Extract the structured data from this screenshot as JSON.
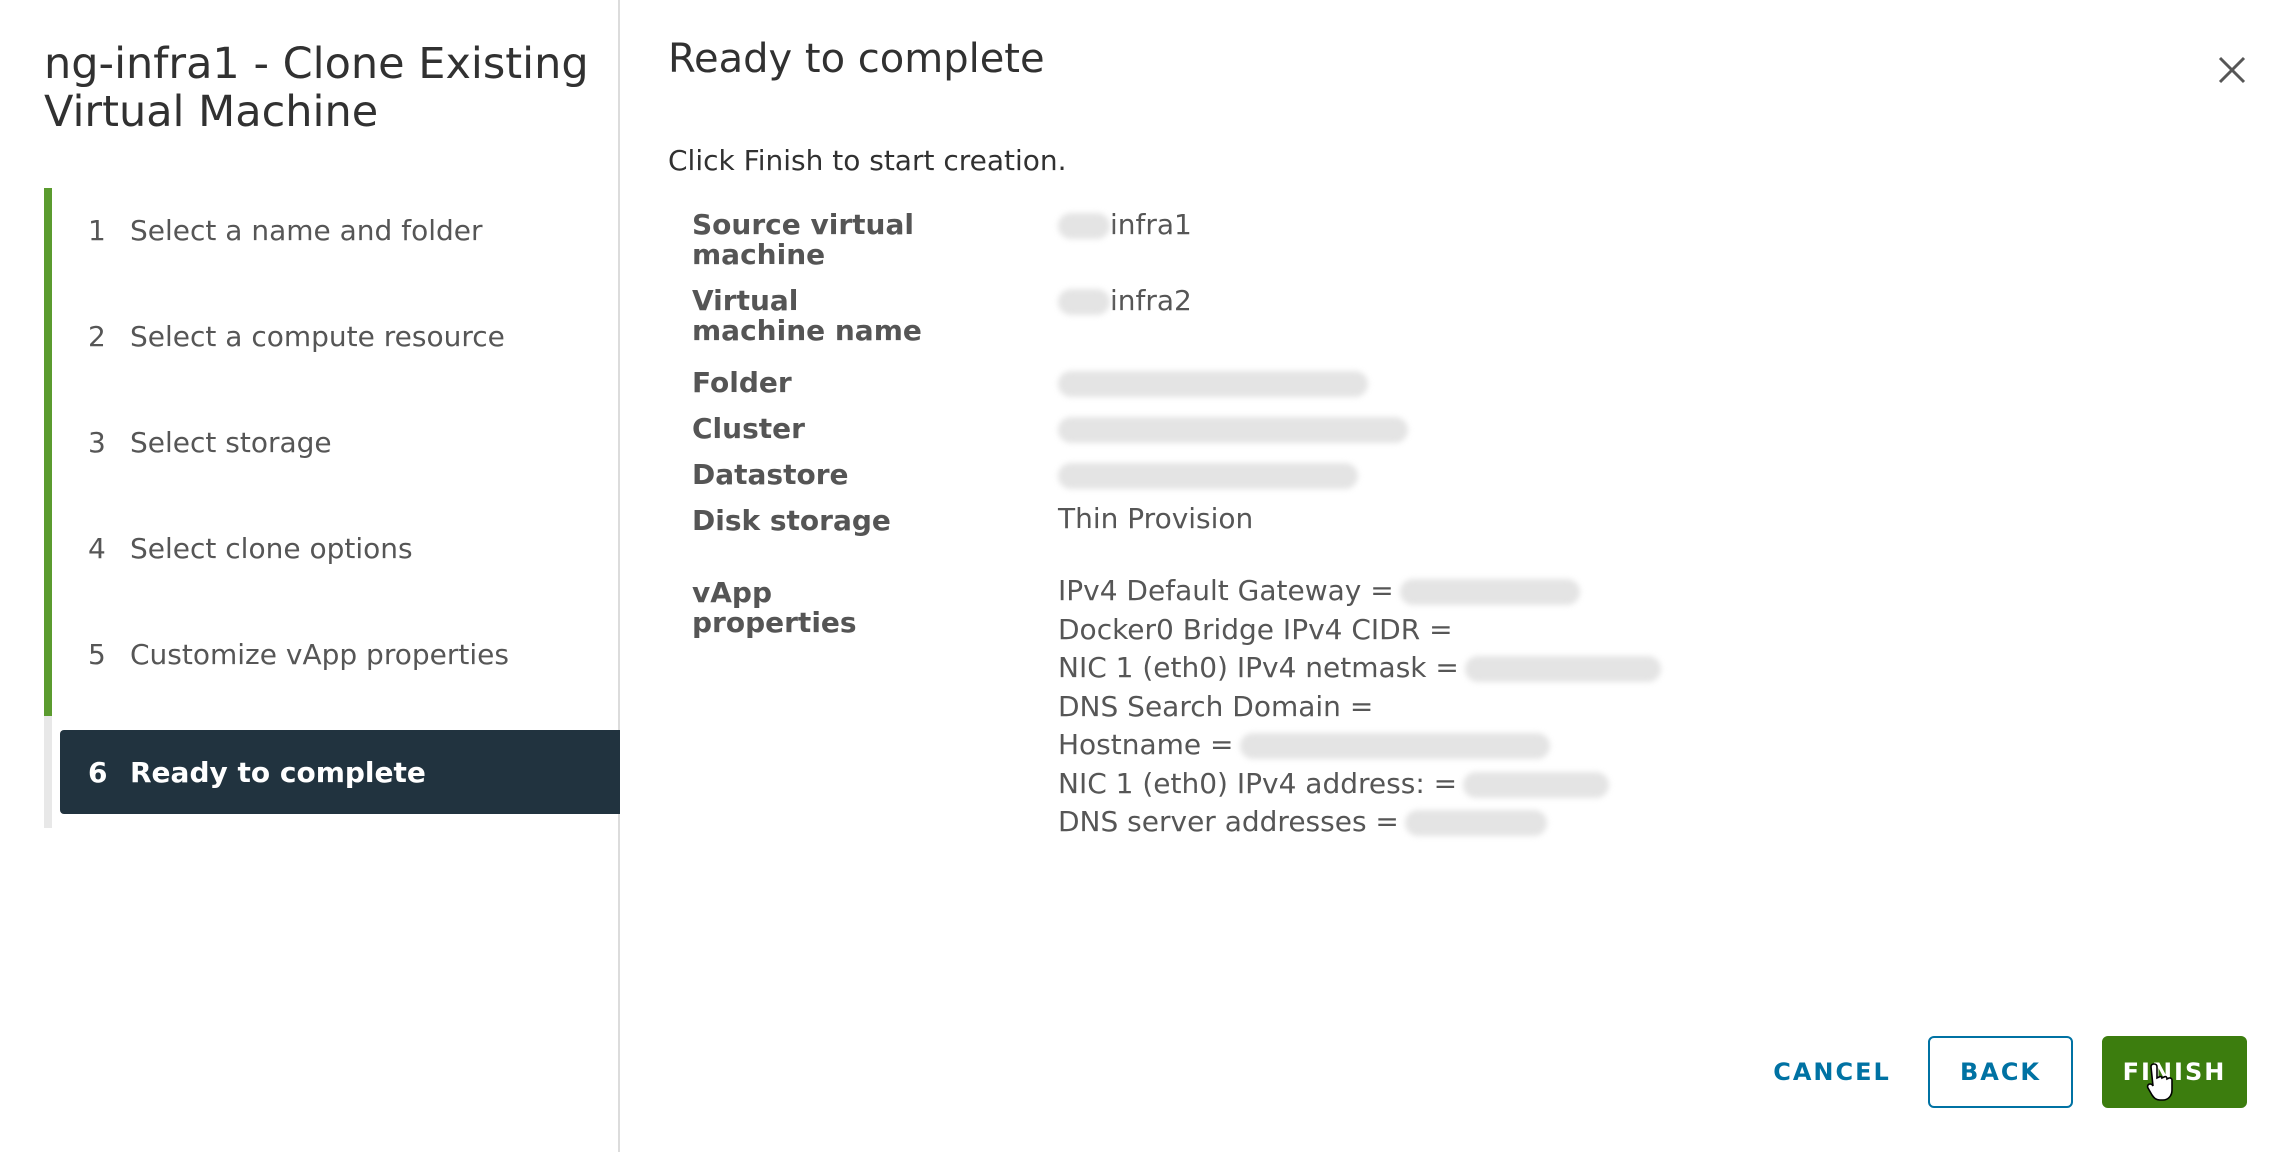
{
  "dialog": {
    "title": "ng-infra1 - Clone Existing Virtual Machine"
  },
  "steps": [
    {
      "number": "1",
      "label": "Select a name and folder"
    },
    {
      "number": "2",
      "label": "Select a compute resource"
    },
    {
      "number": "3",
      "label": "Select storage"
    },
    {
      "number": "4",
      "label": "Select clone options"
    },
    {
      "number": "5",
      "label": "Customize vApp properties"
    },
    {
      "number": "6",
      "label": "Ready to complete"
    }
  ],
  "active_step": "6",
  "main": {
    "title": "Ready to complete",
    "intro": "Click Finish to start creation."
  },
  "summary": {
    "source_vm": {
      "key": "Source virtual machine",
      "value": "infra1"
    },
    "vm_name": {
      "key": "Virtual machine name",
      "value": "infra2"
    },
    "folder": {
      "key": "Folder"
    },
    "cluster": {
      "key": "Cluster"
    },
    "datastore": {
      "key": "Datastore"
    },
    "disk_storage": {
      "key": "Disk storage",
      "value": "Thin Provision"
    },
    "vapp": {
      "key": "vApp properties",
      "lines": [
        "IPv4 Default Gateway =",
        "Docker0 Bridge IPv4 CIDR =",
        "NIC 1 (eth0) IPv4 netmask =",
        "DNS Search Domain =",
        "Hostname =",
        "NIC 1 (eth0) IPv4 address: =",
        "DNS server addresses ="
      ]
    }
  },
  "buttons": {
    "cancel": "CANCEL",
    "back": "BACK",
    "finish": "FINISH"
  },
  "colors": {
    "accent_green": "#5b9b2f",
    "finish_green": "#3c7d0e",
    "active_step_bg": "#21333f",
    "link_blue": "#0072a3"
  },
  "icons": {
    "close": "close-icon",
    "cursor": "hand-pointer-icon"
  }
}
